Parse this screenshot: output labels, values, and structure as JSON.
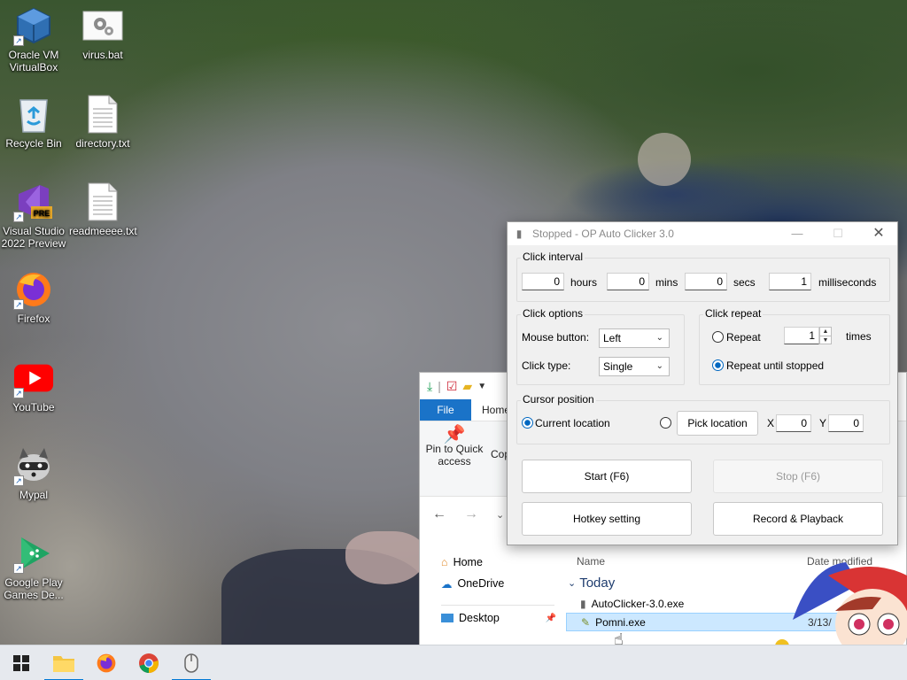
{
  "desktop": {
    "icons": [
      {
        "label": "Oracle VM VirtualBox",
        "icon": "virtualbox-icon"
      },
      {
        "label": "virus.bat",
        "icon": "batch-file-icon"
      },
      {
        "label": "Recycle Bin",
        "icon": "recycle-bin-icon"
      },
      {
        "label": "directory.txt",
        "icon": "text-file-icon"
      },
      {
        "label": "Visual Studio 2022 Preview",
        "icon": "visual-studio-icon",
        "badge": "PRE"
      },
      {
        "label": "readmeeee.txt",
        "icon": "text-file-icon"
      },
      {
        "label": "Firefox",
        "icon": "firefox-icon"
      },
      {
        "label": "YouTube",
        "icon": "youtube-icon"
      },
      {
        "label": "Mypal",
        "icon": "raccoon-icon"
      },
      {
        "label": "Google Play Games De...",
        "icon": "google-play-games-icon"
      }
    ]
  },
  "explorer": {
    "tabs": {
      "file": "File",
      "home": "Home"
    },
    "ribbon": {
      "pin_label": "Pin to Quick access",
      "copy_label": "Cop"
    },
    "nav": [
      {
        "label": "Home",
        "icon": "home-icon"
      },
      {
        "label": "OneDrive",
        "icon": "cloud-icon"
      },
      {
        "label": "Desktop",
        "icon": "desktop-folder-icon"
      }
    ],
    "columns": {
      "name": "Name",
      "date": "Date modified"
    },
    "group": "Today",
    "files": [
      {
        "name": "AutoClicker-3.0.exe",
        "date": "",
        "selected": false
      },
      {
        "name": "Pomni.exe",
        "date": "3/13/",
        "selected": true
      }
    ]
  },
  "autoclicker": {
    "title": "Stopped - OP Auto Clicker 3.0",
    "click_interval": {
      "label": "Click interval",
      "hours": "0",
      "hours_label": "hours",
      "mins": "0",
      "mins_label": "mins",
      "secs": "0",
      "secs_label": "secs",
      "ms": "1",
      "ms_label": "milliseconds"
    },
    "click_options": {
      "label": "Click options",
      "mouse_button_label": "Mouse button:",
      "mouse_button_value": "Left",
      "click_type_label": "Click type:",
      "click_type_value": "Single"
    },
    "click_repeat": {
      "label": "Click repeat",
      "repeat_label": "Repeat",
      "repeat_value": "1",
      "times_label": "times",
      "until_stopped_label": "Repeat until stopped",
      "selected": "until_stopped"
    },
    "cursor_position": {
      "label": "Cursor position",
      "current_label": "Current location",
      "pick_label": "Pick location",
      "x_label": "X",
      "x_value": "0",
      "y_label": "Y",
      "y_value": "0",
      "selected": "current"
    },
    "buttons": {
      "start": "Start (F6)",
      "stop": "Stop (F6)",
      "hotkey": "Hotkey setting",
      "record": "Record & Playback"
    }
  },
  "taskbar": {
    "items": [
      {
        "icon": "windows-start-icon"
      },
      {
        "icon": "file-explorer-icon"
      },
      {
        "icon": "firefox-icon"
      },
      {
        "icon": "chrome-icon"
      },
      {
        "icon": "mouse-icon"
      }
    ]
  }
}
